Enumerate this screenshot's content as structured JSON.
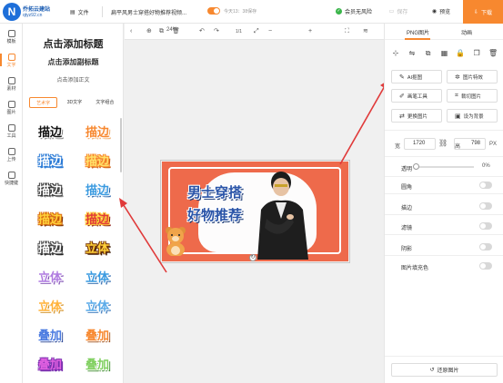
{
  "topbar": {
    "logo_letter": "N",
    "brand": "乔拓云建站",
    "domain": "qtyz92.cn",
    "file_label": "文件",
    "doc_title": "扁平风男士穿搭好物推荐视频...",
    "autosave_text": "今天13：38保存",
    "no_copyright": "会员无风险",
    "save_label": "保存",
    "preview_label": "预览",
    "download_label": "下载",
    "accent": "#f7882f"
  },
  "rail": [
    {
      "label": "模板",
      "icon": "template-icon"
    },
    {
      "label": "文字",
      "icon": "text-icon"
    },
    {
      "label": "素材",
      "icon": "material-icon"
    },
    {
      "label": "图片",
      "icon": "image-icon"
    },
    {
      "label": "工具",
      "icon": "tools-icon"
    },
    {
      "label": "上传",
      "icon": "upload-icon"
    },
    {
      "label": "快捷键",
      "icon": "shortcut-icon"
    }
  ],
  "panel": {
    "add_title": "点击添加标题",
    "add_subtitle": "点击添加副标题",
    "add_body": "点击添加正文",
    "tabs": [
      "艺术字",
      "3D文字",
      "文字组合"
    ],
    "tiles": [
      {
        "text": "描边",
        "color": "#111111",
        "stroke": "#ffffff",
        "shadow": "#888888"
      },
      {
        "text": "描边",
        "color": "#f7882f",
        "stroke": "#ffffff",
        "shadow": "#f0b070"
      },
      {
        "text": "描边",
        "color": "#ffffff",
        "stroke": "#2b7bd6",
        "shadow": "#2b7bd6"
      },
      {
        "text": "描边",
        "color": "#ffe26a",
        "stroke": "#f7882f",
        "shadow": "#c8621a"
      },
      {
        "text": "描边",
        "color": "#ffffff",
        "stroke": "#333333",
        "shadow": "#999999"
      },
      {
        "text": "描边",
        "color": "#3a9ae0",
        "stroke": "#ffffff",
        "shadow": "#1f5fa8"
      },
      {
        "text": "描边",
        "color": "#ffd23a",
        "stroke": "#d96a12",
        "shadow": "#7a3808"
      },
      {
        "text": "描边",
        "color": "#e03a3a",
        "stroke": "#ffd23a",
        "shadow": "#8a1a1a"
      },
      {
        "text": "描边",
        "color": "#ffffff",
        "stroke": "#444444",
        "shadow": "#222222"
      },
      {
        "text": "立体",
        "color": "#ffd23a",
        "stroke": "#7a3808",
        "shadow": "#3a1a04"
      },
      {
        "text": "立体",
        "color": "#b07be0",
        "stroke": "#ffffff",
        "shadow": "#7a48b0"
      },
      {
        "text": "立体",
        "color": "#3a9ae0",
        "stroke": "#ffffff",
        "shadow": "#1f5fa8"
      },
      {
        "text": "立体",
        "color": "#ffb23a",
        "stroke": "#ffffff",
        "shadow": "#d08a18"
      },
      {
        "text": "立体",
        "color": "#5aaae8",
        "stroke": "#ffffff",
        "shadow": "#2b6fb8"
      },
      {
        "text": "叠加",
        "color": "#4a7ae0",
        "stroke": "#ffffff",
        "shadow": "#223f90"
      },
      {
        "text": "叠加",
        "color": "#f7882f",
        "stroke": "#ffffff",
        "shadow": "#a0501a"
      },
      {
        "text": "叠加",
        "color": "#e060e0",
        "stroke": "#7a30b0",
        "shadow": "#7a30b0"
      },
      {
        "text": "叠加",
        "color": "#80d060",
        "stroke": "#ffffff",
        "shadow": "#3a8a2a"
      }
    ]
  },
  "canvas_toolbar": {
    "page_indicator": "1/1",
    "zoom": "24%"
  },
  "poster": {
    "line1": "男士穿搭",
    "line2": "好物推荐",
    "bg_color": "#ee6a4b"
  },
  "right": {
    "tabs": [
      "PNG图片",
      "动画"
    ],
    "buttons": [
      {
        "label": "AI抠图",
        "icon": "ai-cutout-icon",
        "glyph": "✎"
      },
      {
        "label": "图片特效",
        "icon": "effect-icon",
        "glyph": "✲"
      },
      {
        "label": "画笔工具",
        "icon": "brush-icon",
        "glyph": "✐"
      },
      {
        "label": "裁切图片",
        "icon": "crop-icon",
        "glyph": "⌗"
      },
      {
        "label": "更换图片",
        "icon": "replace-icon",
        "glyph": "⇄"
      },
      {
        "label": "设为背景",
        "icon": "background-icon",
        "glyph": "▣"
      }
    ],
    "width_label": "宽",
    "width_value": "1720",
    "height_label": "高",
    "height_value": "798",
    "unit": "PX",
    "opacity_label": "透明",
    "opacity_value": "0%",
    "opacity_level": 0,
    "toggles": [
      "圆角",
      "描边",
      "滤镜",
      "阴影",
      "图片填充色"
    ],
    "restore_label": "还原图片"
  }
}
